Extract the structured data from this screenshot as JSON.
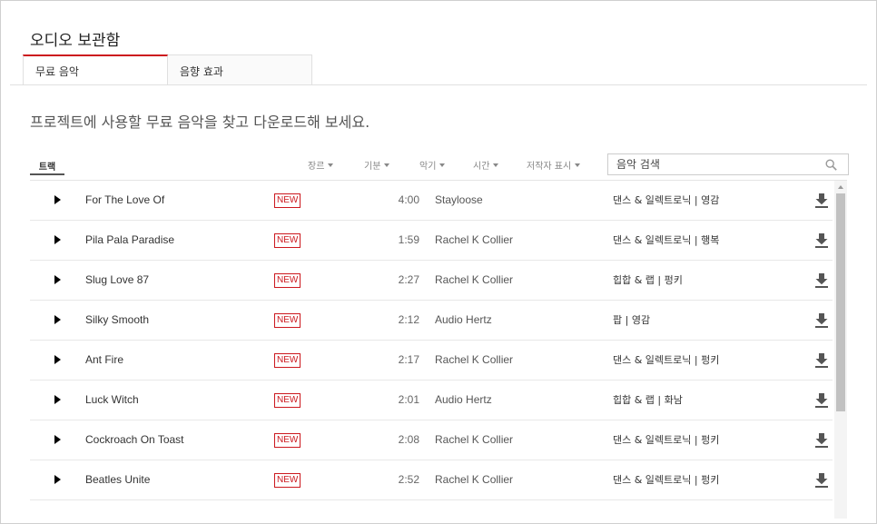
{
  "page_title": "오디오 보관함",
  "tabs": [
    {
      "label": "무료 음악",
      "active": true
    },
    {
      "label": "음향 효과",
      "active": false
    }
  ],
  "intro": "프로젝트에 사용할 무료 음악을 찾고 다운로드해 보세요.",
  "track_tab_label": "트랙",
  "filters": [
    "장르",
    "기분",
    "악기",
    "시간",
    "저작자 표시"
  ],
  "search": {
    "placeholder": "음악 검색",
    "value": ""
  },
  "badge_label": "NEW",
  "tracks": [
    {
      "title": "For The Love Of",
      "duration": "4:00",
      "artist": "Stayloose",
      "genre": "댄스 & 일렉트로닉 | 영감"
    },
    {
      "title": "Pila Pala Paradise",
      "duration": "1:59",
      "artist": "Rachel K Collier",
      "genre": "댄스 & 일렉트로닉 | 행복"
    },
    {
      "title": "Slug Love 87",
      "duration": "2:27",
      "artist": "Rachel K Collier",
      "genre": "힙합 & 랩 | 펑키"
    },
    {
      "title": "Silky Smooth",
      "duration": "2:12",
      "artist": "Audio Hertz",
      "genre": "팝 | 영감"
    },
    {
      "title": "Ant Fire",
      "duration": "2:17",
      "artist": "Rachel K Collier",
      "genre": "댄스 & 일렉트로닉 | 펑키"
    },
    {
      "title": "Luck Witch",
      "duration": "2:01",
      "artist": "Audio Hertz",
      "genre": "힙합 & 랩 | 화남"
    },
    {
      "title": "Cockroach On Toast",
      "duration": "2:08",
      "artist": "Rachel K Collier",
      "genre": "댄스 & 일렉트로닉 | 펑키"
    },
    {
      "title": "Beatles Unite",
      "duration": "2:52",
      "artist": "Rachel K Collier",
      "genre": "댄스 & 일렉트로닉 | 펑키"
    }
  ],
  "colors": {
    "accent": "#cc181e",
    "text": "#333333"
  },
  "icons": {
    "play": "play-icon",
    "download": "download-icon",
    "search": "search-icon"
  }
}
